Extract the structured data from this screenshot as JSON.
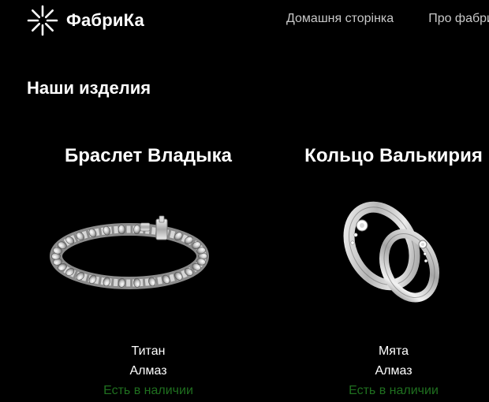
{
  "brand": {
    "name": "ФабриКа",
    "logo_icon": "starburst-icon"
  },
  "nav": {
    "items": [
      {
        "label": "Домашня сторінка"
      },
      {
        "label": "Про фабрику"
      }
    ]
  },
  "section": {
    "title": "Наши изделия"
  },
  "products": [
    {
      "name": "Браслет Владыка",
      "image_icon": "diamond-tennis-bracelet-image",
      "metal": "Титан",
      "stone": "Алмаз",
      "availability": "Есть в наличии"
    },
    {
      "name": "Кольцо Валькирия",
      "image_icon": "wedding-rings-pair-image",
      "metal": "Мята",
      "stone": "Алмаз",
      "availability": "Есть в наличии"
    }
  ],
  "colors": {
    "background": "#000000",
    "text": "#ffffff",
    "nav_text": "#c8c8c8",
    "availability": "#1f6f1f"
  }
}
